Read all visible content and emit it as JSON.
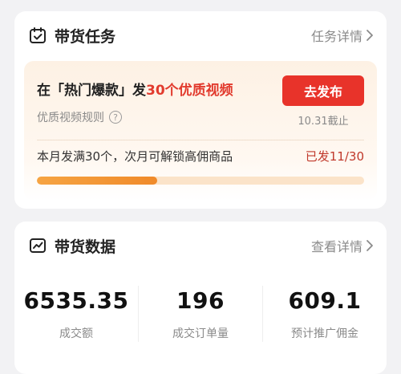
{
  "task_card": {
    "title": "带货任务",
    "detail_link": "任务详情",
    "icon": "calendar-check-icon",
    "task": {
      "title_prefix": "在「热门爆款」发",
      "title_highlight": "30个优质视频",
      "rule_text": "优质视频规则",
      "publish_button": "去发布",
      "deadline": "10.31截止",
      "progress_desc": "本月发满30个，次月可解锁高佣商品",
      "progress_count": "已发11/30",
      "progress_done": 11,
      "progress_total": 30
    }
  },
  "data_card": {
    "title": "带货数据",
    "detail_link": "查看详情",
    "icon": "trend-chart-icon",
    "stats": [
      {
        "value": "6535.35",
        "label": "成交额"
      },
      {
        "value": "196",
        "label": "成交订单量"
      },
      {
        "value": "609.1",
        "label": "预计推广佣金"
      }
    ]
  },
  "colors": {
    "accent_red": "#e8332a",
    "progress_orange": "#f08a2a",
    "background": "#f2f2f4"
  }
}
